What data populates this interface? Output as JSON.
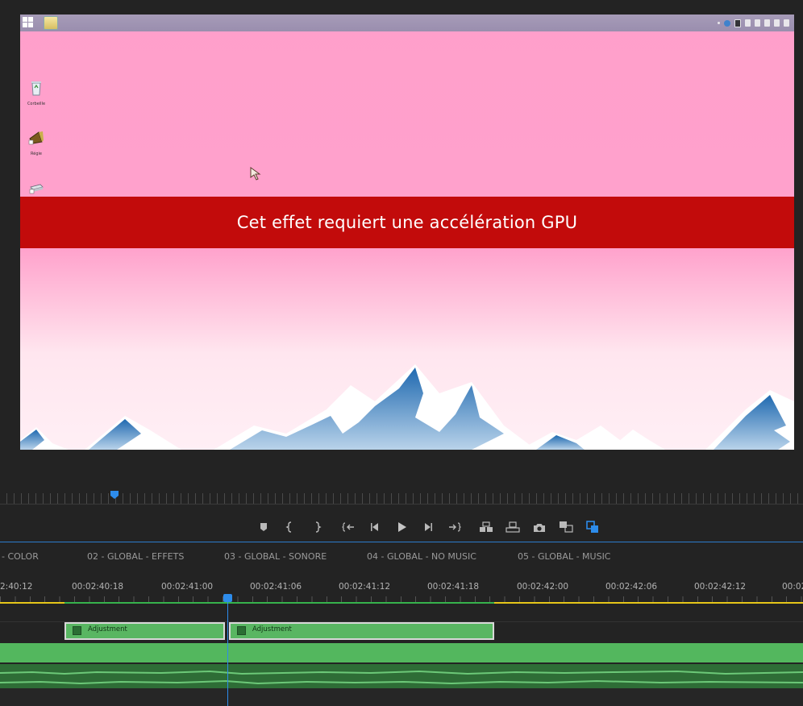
{
  "monitor": {
    "banner_text": "Cet effet requiert une accélération GPU",
    "desktop_icons": [
      {
        "label": "Corbeille",
        "icon": "recycle-bin-icon"
      },
      {
        "label": "Régie",
        "icon": "megaphone-icon"
      },
      {
        "label": "",
        "icon": "drive-icon"
      }
    ]
  },
  "transport": {
    "buttons": [
      "add-marker",
      "mark-in",
      "mark-out",
      "go-to-in",
      "step-back",
      "play",
      "step-forward",
      "go-to-out",
      "insert",
      "overwrite",
      "export-frame",
      "comparison-view",
      "toggle-proxies"
    ]
  },
  "sequence_tabs": [
    "- COLOR",
    "02 - GLOBAL  - EFFETS",
    "03 - GLOBAL  - SONORE",
    "04 - GLOBAL  - NO MUSIC",
    "05 - GLOBAL  - MUSIC"
  ],
  "timecodes": [
    "2:40:12",
    "00:02:40:18",
    "00:02:41:00",
    "00:02:41:06",
    "00:02:41:12",
    "00:02:41:18",
    "00:02:42:00",
    "00:02:42:06",
    "00:02:42:12",
    "00:02"
  ],
  "clips": [
    {
      "name": "Adjustment"
    },
    {
      "name": "Adjustment"
    }
  ],
  "colors": {
    "accent": "#2d8ceb",
    "banner": "#c20b0b",
    "clip_green": "#59b662",
    "work_area_yellow": "#e6c619"
  }
}
